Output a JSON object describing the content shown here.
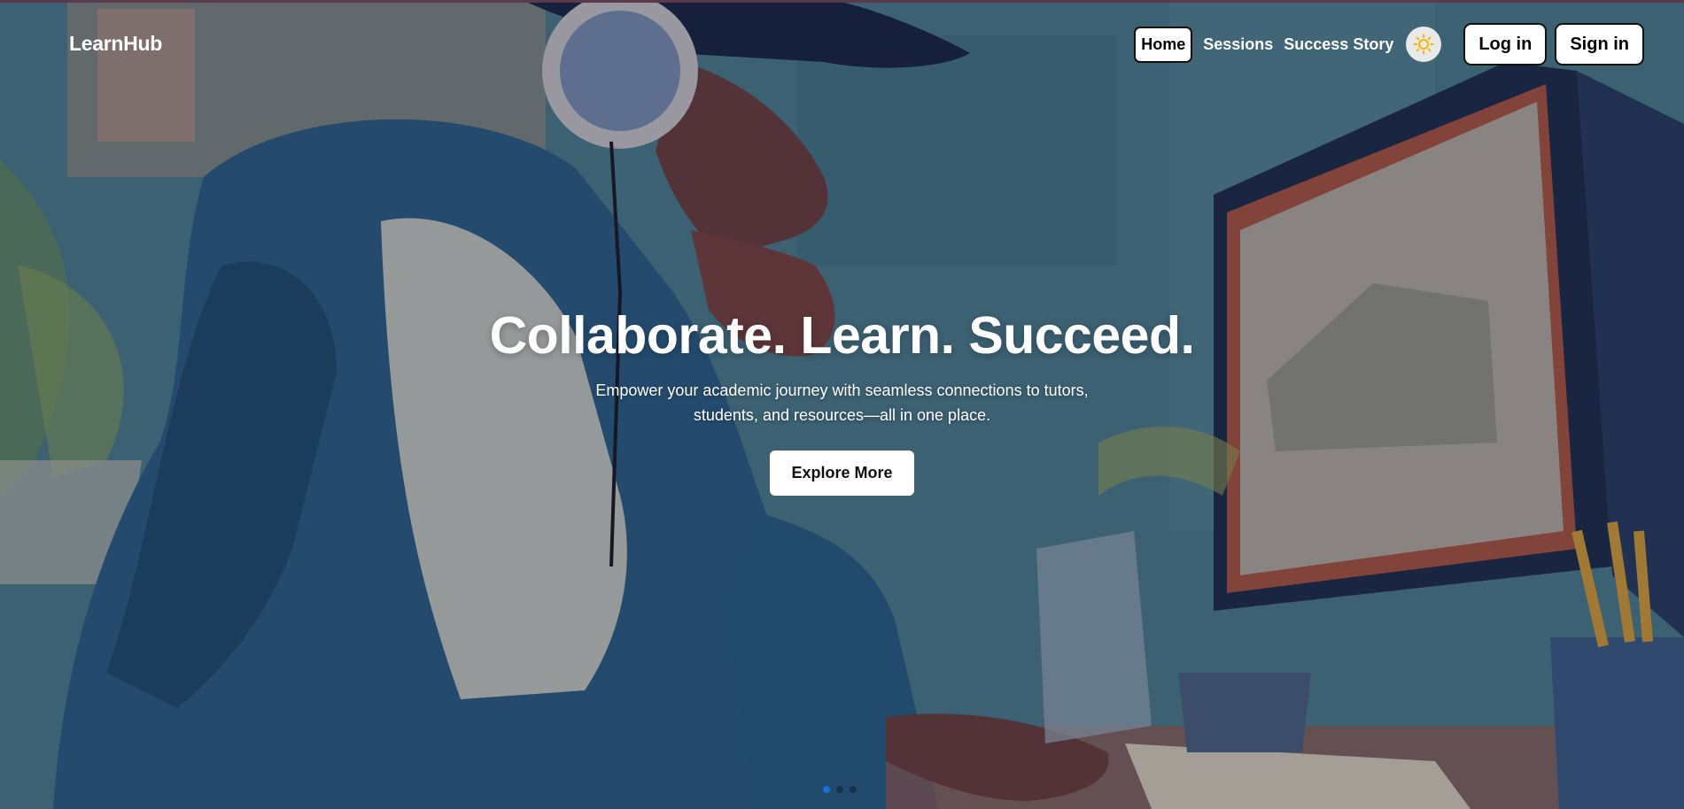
{
  "brand": {
    "name": "LearnHub"
  },
  "nav": {
    "links": [
      {
        "label": "Home",
        "active": true
      },
      {
        "label": "Sessions",
        "active": false
      },
      {
        "label": "Success Story",
        "active": false
      }
    ],
    "theme_toggle_icon": "sun-icon",
    "login_label": "Log in",
    "signin_label": "Sign in"
  },
  "hero": {
    "headline": "Collaborate. Learn. Succeed.",
    "subtext": "Empower your academic journey with seamless connections to tutors, students, and resources—all in one place.",
    "cta_label": "Explore More",
    "background_image": "illustration of student with headphones at computer",
    "carousel": {
      "total": 3,
      "active_index": 0
    }
  },
  "colors": {
    "accent": "#1a6fd6",
    "sun": "#f2b705",
    "nav_text": "#ffffff"
  }
}
